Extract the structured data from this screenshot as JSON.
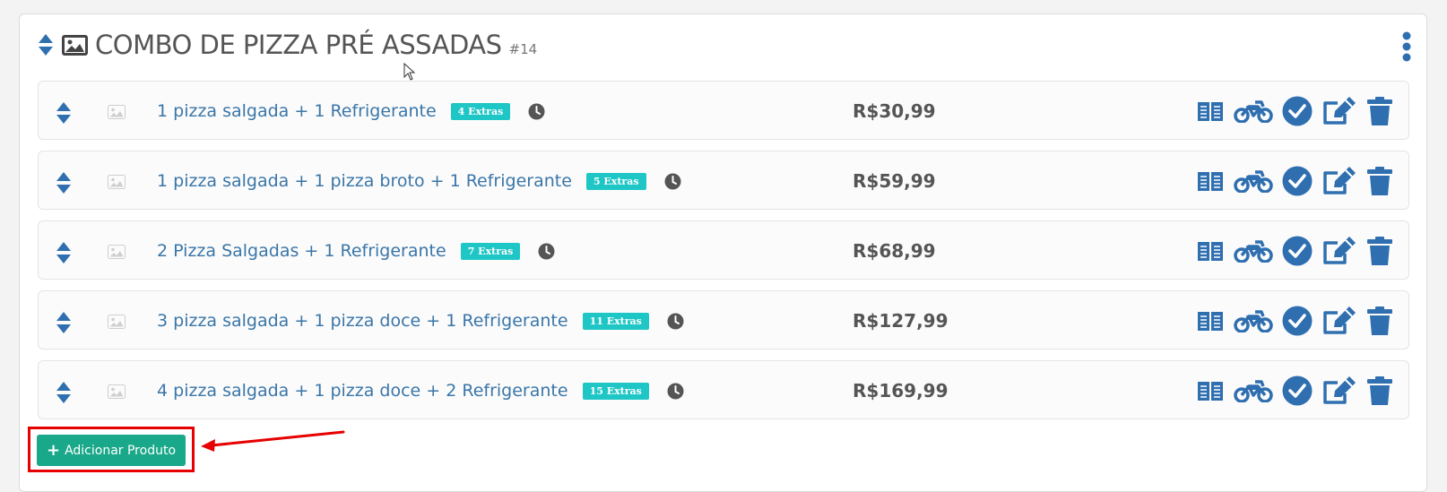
{
  "category": {
    "title": "COMBO DE PIZZA PRÉ ASSADAS",
    "id": "#14"
  },
  "products": [
    {
      "name": "1 pizza salgada + 1 Refrigerante",
      "extras": "4 Extras",
      "price": "R$30,99"
    },
    {
      "name": "1 pizza salgada + 1 pizza broto + 1 Refrigerante",
      "extras": "5 Extras",
      "price": "R$59,99"
    },
    {
      "name": "2 Pizza Salgadas + 1 Refrigerante",
      "extras": "7 Extras",
      "price": "R$68,99"
    },
    {
      "name": "3 pizza salgada + 1 pizza doce + 1 Refrigerante",
      "extras": "11 Extras",
      "price": "R$127,99"
    },
    {
      "name": "4 pizza salgada + 1 pizza doce + 2 Refrigerante",
      "extras": "15 Extras",
      "price": "R$169,99"
    }
  ],
  "actions": {
    "add_product_label": "Adicionar Produto"
  },
  "icons": {
    "sort": "sort-icon",
    "image": "image-icon",
    "menu": "kebab-menu-icon",
    "clock": "clock-icon",
    "menu_book": "book-icon",
    "delivery": "motorcycle-icon",
    "active": "check-circle-icon",
    "edit": "edit-icon",
    "delete": "trash-icon"
  },
  "colors": {
    "primary": "#2f6fb0",
    "link": "#3a76a8",
    "extras_badge": "#1fc6c6",
    "add_button": "#19a889",
    "highlight": "#e60000"
  }
}
